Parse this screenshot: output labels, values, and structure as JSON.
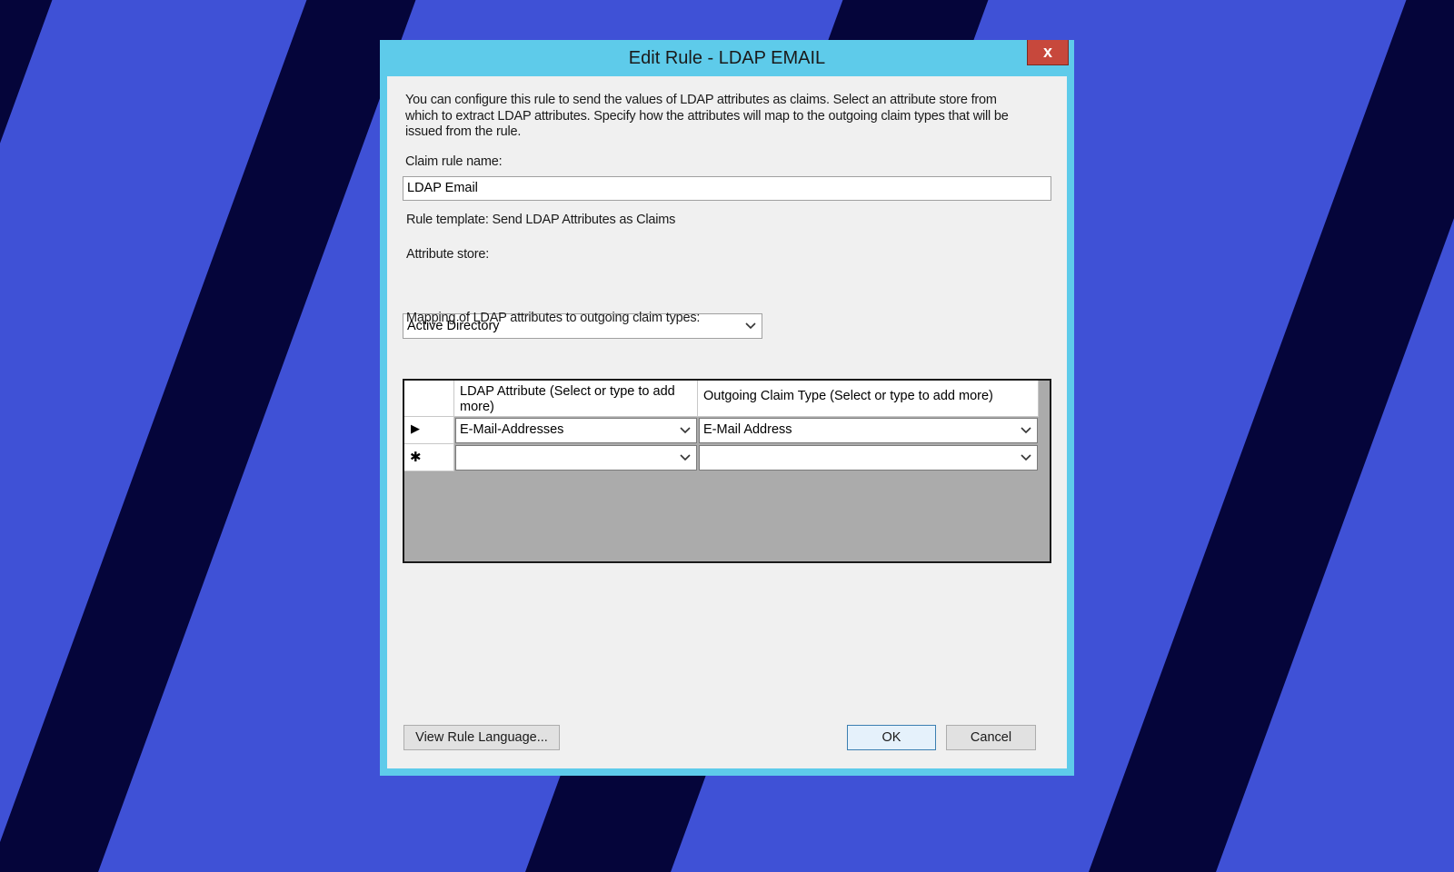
{
  "window": {
    "title": "Edit Rule - LDAP EMAIL",
    "close_label": "x"
  },
  "description": "You can configure this rule to send the values of LDAP attributes as claims. Select an attribute store from which to extract LDAP attributes. Specify how the attributes will map to the outgoing claim types that will be issued from the rule.",
  "claim_rule_name": {
    "label": "Claim rule name:",
    "value": "LDAP Email"
  },
  "rule_template": "Rule template: Send LDAP Attributes as Claims",
  "attribute_store": {
    "label": "Attribute store:",
    "selected": "Active Directory"
  },
  "mapping": {
    "label": "Mapping of LDAP attributes to outgoing claim types:",
    "columns": [
      "LDAP Attribute (Select or type to add more)",
      "Outgoing Claim Type (Select or type to add more)"
    ],
    "rows": [
      {
        "ldap_attribute": "E-Mail-Addresses",
        "claim_type": "E-Mail Address"
      },
      {
        "ldap_attribute": "",
        "claim_type": ""
      }
    ],
    "current_row_marker": "▶",
    "new_row_marker": "✱"
  },
  "buttons": {
    "view_rule_language": "View Rule Language...",
    "ok": "OK",
    "cancel": "Cancel"
  },
  "colors": {
    "desktop_background": "#3f51d6",
    "stripe": "#05053a",
    "window_frame": "#5ecbea",
    "close_button": "#c7483c",
    "grid_empty_area": "#ababab"
  }
}
